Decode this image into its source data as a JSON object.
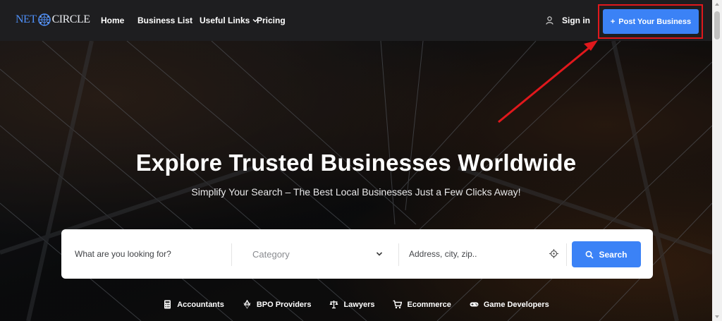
{
  "header": {
    "logo": {
      "part1": "NET",
      "part2": "CIRCLE"
    },
    "nav": [
      {
        "label": "Home"
      },
      {
        "label": "Business List"
      },
      {
        "label": "Useful Links"
      },
      {
        "label": "Pricing"
      }
    ],
    "signin_label": "Sign in",
    "post_button_label": "Post Your Business"
  },
  "hero": {
    "title": "Explore Trusted Businesses Worldwide",
    "subtitle": "Simplify Your Search – The Best Local Businesses Just a Few Clicks Away!"
  },
  "search": {
    "what_placeholder": "What are you looking for?",
    "category_placeholder": "Category",
    "address_placeholder": "Address, city, zip..",
    "button_label": "Search"
  },
  "categories": [
    {
      "label": "Accountants",
      "icon": "calculator-icon"
    },
    {
      "label": "BPO Providers",
      "icon": "recycle-icon"
    },
    {
      "label": "Lawyers",
      "icon": "scales-icon"
    },
    {
      "label": "Ecommerce",
      "icon": "cart-icon"
    },
    {
      "label": "Game Developers",
      "icon": "gamepad-icon"
    }
  ],
  "colors": {
    "accent": "#3b82f6",
    "highlight": "#e0181c",
    "header_bg": "#1e1e20"
  }
}
